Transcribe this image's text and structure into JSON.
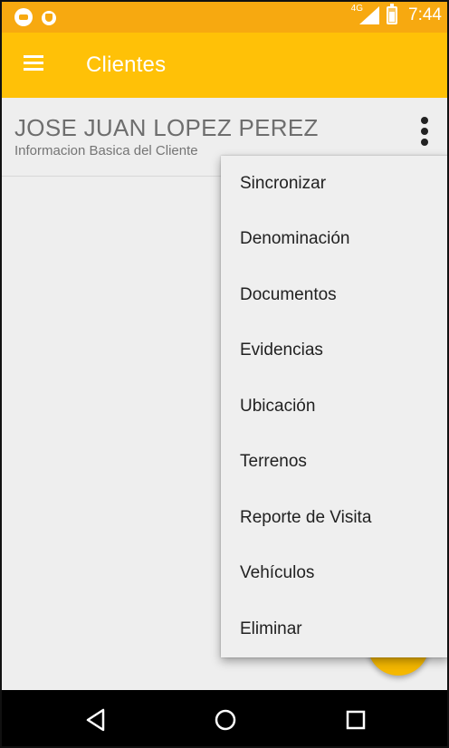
{
  "status_bar": {
    "network": "4G",
    "time": "7:44",
    "icons": [
      "chat-notification-icon",
      "shield-notification-icon",
      "signal-icon",
      "battery-icon"
    ],
    "color": "#f7a910"
  },
  "app_bar": {
    "title": "Clientes",
    "color": "#ffc107"
  },
  "client": {
    "name": "JOSE JUAN LOPEZ PEREZ",
    "subtitle": "Informacion Basica del Cliente"
  },
  "menu": {
    "items": [
      {
        "label": "Sincronizar"
      },
      {
        "label": "Denominación"
      },
      {
        "label": "Documentos"
      },
      {
        "label": "Evidencias"
      },
      {
        "label": "Ubicación"
      },
      {
        "label": "Terrenos"
      },
      {
        "label": "Reporte de Visita"
      },
      {
        "label": "Vehículos"
      },
      {
        "label": "Eliminar"
      }
    ]
  },
  "nav_bar": {
    "buttons": [
      "back-icon",
      "home-icon",
      "recents-icon"
    ]
  }
}
